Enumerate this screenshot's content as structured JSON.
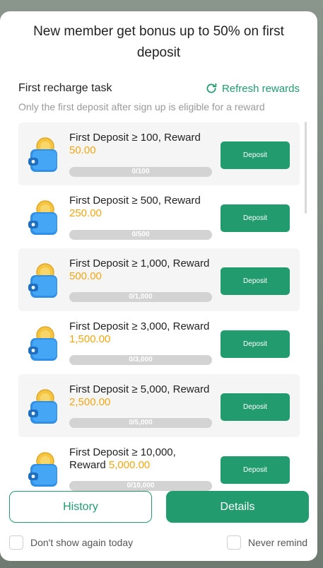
{
  "modal": {
    "title": "New member get bonus up to 50% on first deposit"
  },
  "task_panel": {
    "title": "First recharge task",
    "refresh_label": "Refresh rewards",
    "subtitle": "Only the first deposit after sign up is eligible for a reward"
  },
  "tasks": [
    {
      "text": "First Deposit ≥ 100, Reward",
      "reward": "50.00",
      "progress_text": "0/100",
      "progress": 0,
      "button": "Deposit"
    },
    {
      "text": "First Deposit ≥ 500, Reward",
      "reward": "250.00",
      "progress_text": "0/500",
      "progress": 0,
      "button": "Deposit"
    },
    {
      "text": "First Deposit ≥ 1,000, Reward",
      "reward": "500.00",
      "progress_text": "0/1,000",
      "progress": 0,
      "button": "Deposit"
    },
    {
      "text": "First Deposit ≥ 3,000, Reward",
      "reward": "1,500.00",
      "progress_text": "0/3,000",
      "progress": 0,
      "button": "Deposit"
    },
    {
      "text": "First Deposit ≥ 5,000, Reward",
      "reward": "2,500.00",
      "progress_text": "0/5,000",
      "progress": 0,
      "button": "Deposit"
    },
    {
      "text": "First Deposit ≥ 10,000, Reward",
      "reward": "5,000.00",
      "progress_text": "0/10,000",
      "progress": 0,
      "button": "Deposit"
    }
  ],
  "footer": {
    "history_label": "History",
    "details_label": "Details",
    "dont_show_label": "Don't show again today",
    "never_remind_label": "Never remind"
  },
  "colors": {
    "accent": "#229b6e",
    "reward": "#f2a712",
    "progress_track": "#d3d3d3"
  },
  "icons": {
    "refresh": "refresh-icon",
    "task": "wallet-coin-icon"
  }
}
